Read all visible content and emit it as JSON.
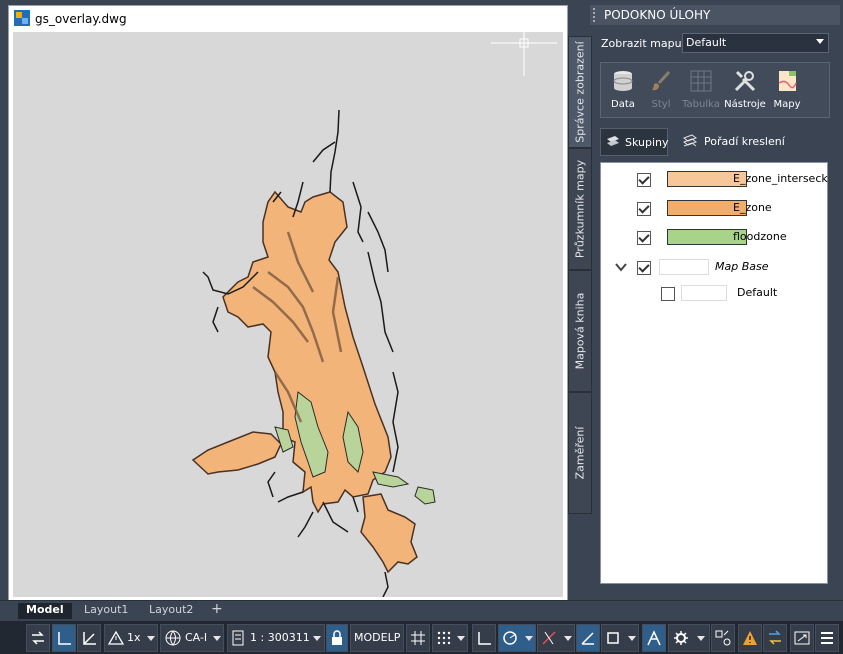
{
  "drawing": {
    "filename": "gs_overlay.dwg"
  },
  "task_pane": {
    "title": "PODOKNO ÚLOHY",
    "side_tabs": [
      "Správce zobrazení",
      "Průzkumník mapy",
      "Mapová kniha",
      "Zaměření"
    ],
    "map_label": "Zobrazit mapu:",
    "map_value": "Default",
    "toolbar": [
      {
        "label": "Data",
        "icon": "database-icon",
        "enabled": true
      },
      {
        "label": "Styl",
        "icon": "brush-icon",
        "enabled": false
      },
      {
        "label": "Tabulka",
        "icon": "table-icon",
        "enabled": false
      },
      {
        "label": "Nástroje",
        "icon": "tools-icon",
        "enabled": true
      },
      {
        "label": "Mapy",
        "icon": "map-icon",
        "enabled": true
      }
    ],
    "groups_label": "Skupiny",
    "draw_order_label": "Pořadí kreslení",
    "layers": [
      {
        "name": "E_zone_interseck",
        "checked": true,
        "color": "#f7c79a"
      },
      {
        "name": "E_zone",
        "checked": true,
        "color": "#f3ad6a"
      },
      {
        "name": "floodzone",
        "checked": true,
        "color": "#a8d48a"
      },
      {
        "name": "Map Base",
        "checked": true,
        "color": "#ffffff"
      },
      {
        "name": "Default",
        "checked": false,
        "color": "#ffffff"
      }
    ]
  },
  "layout_tabs": [
    "Model",
    "Layout1",
    "Layout2"
  ],
  "status": {
    "scale_ratio": "1x",
    "coord_system": "CA-I",
    "scale": "1 : 300311",
    "space": "MODELP"
  },
  "colors": {
    "e_zone": "#f3b47a",
    "e_zone_border": "#4a3222",
    "flood": "#b9d49a",
    "canvas": "#d8d8d8"
  }
}
